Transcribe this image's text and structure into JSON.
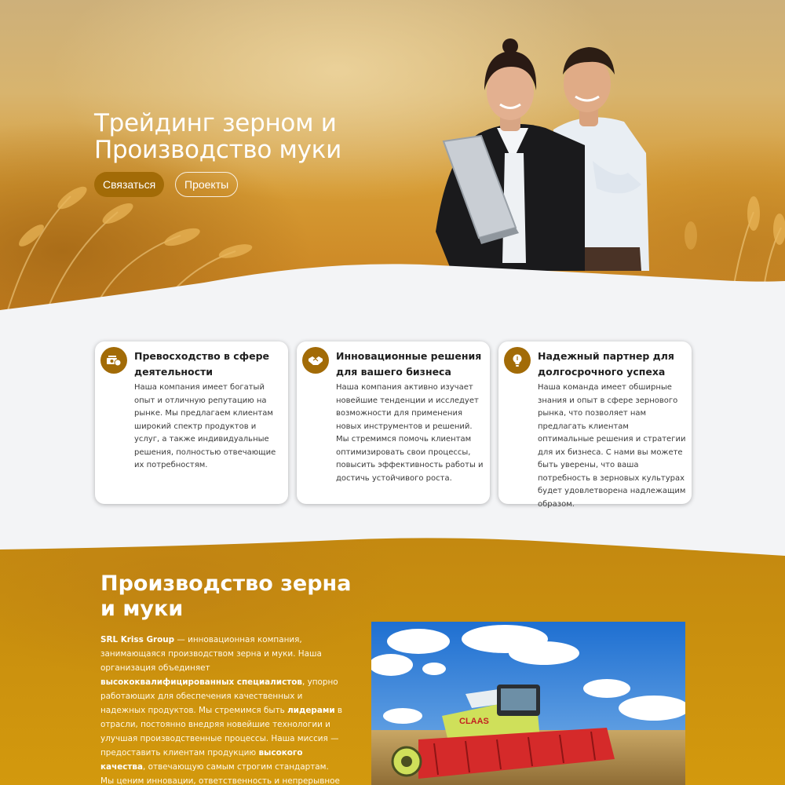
{
  "hero": {
    "title": "Трейдинг зерном и Производство муки",
    "contact_label": "Связаться",
    "projects_label": "Проекты"
  },
  "features": [
    {
      "icon": "money-icon",
      "title": "Превосходство в сфере деятельности",
      "text": "Наша компания имеет богатый опыт и отличную репутацию на рынке. Мы предлагаем клиентам широкий спектр продуктов и услуг, а также индивидуальные решения, полностью отвечающие их потребностям."
    },
    {
      "icon": "handshake-icon",
      "title": "Инновационные решения для вашего бизнеса",
      "text": "Наша компания активно изучает новейшие тенденции и исследует возможности для применения новых инструментов и решений. Мы стремимся помочь клиентам оптимизировать свои процессы, повысить эффективность работы и достичь устойчивого роста."
    },
    {
      "icon": "lightbulb-icon",
      "title": "Надежный партнер для долгосрочного успеха",
      "text": "Наша команда имеет обширные знания и опыт в сфере зернового рынка, что позволяет нам предлагать клиентам оптимальные решения и стратегии для их бизнеса. С нами вы можете быть уверены, что ваша потребность в зерновых культурах будет удовлетворена надлежащим образом."
    }
  ],
  "production": {
    "title": "Производство зерна и муки",
    "p1_company": "SRL Kriss Group",
    "p1_a": " — инновационная компания, занимающаяся производством зерна и муки. Наша организация объединяет ",
    "p1_b1": "высококвалифицированных специалистов",
    "p1_c": ", упорно работающих для обеспечения качественных и надежных продуктов. Мы стремимся быть ",
    "p1_b2": "лидерами",
    "p1_d": " в отрасли, постоянно внедряя новейшие технологии и улучшая производственные процессы. Наша миссия — предоставить клиентам продукцию ",
    "p1_b3": "высокого качества",
    "p1_e": ", отвечающую самым строгим стандартам. Мы ценим инновации, ответственность и непрерывное развитие. Наше производство зерна и муки основано на",
    "photo_brand": "CLAAS"
  },
  "colors": {
    "accent": "#a26b07",
    "section_gold": "#c98f0e",
    "page_bg": "#f3f4f6"
  }
}
